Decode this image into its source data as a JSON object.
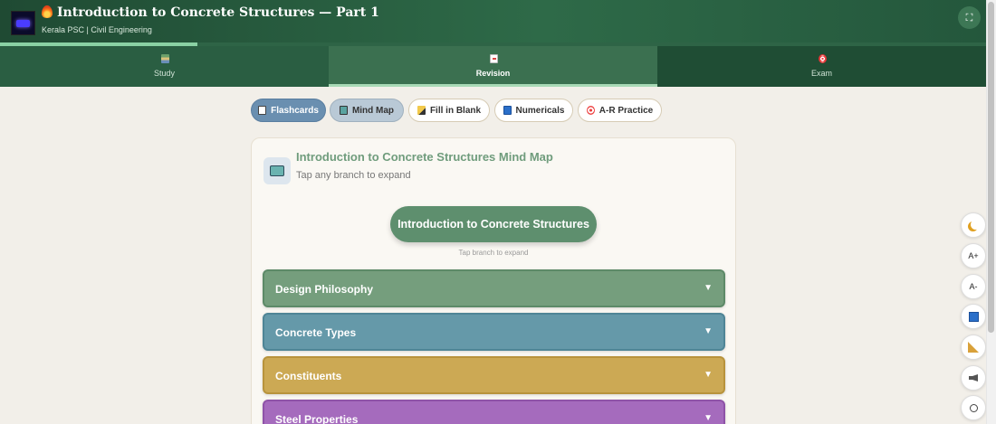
{
  "header": {
    "title": "Introduction to Concrete Structures — Part 1",
    "title_icon": "fire-icon",
    "subtitle": "Kerala PSC | Civil Engineering",
    "expand_icon": "⛶",
    "progress": 0.2
  },
  "tabs": [
    {
      "label": "Study",
      "icon": "books-icon",
      "active": false
    },
    {
      "label": "Revision",
      "icon": "memo-icon",
      "active": true
    },
    {
      "label": "Exam",
      "icon": "target-icon",
      "active": false
    }
  ],
  "modes": [
    {
      "label": "Flashcards",
      "icon": "card-icon",
      "state": "active"
    },
    {
      "label": "Mind Map",
      "icon": "map-icon",
      "state": "selected"
    },
    {
      "label": "Fill in Blank",
      "icon": "pencil-icon",
      "state": "default"
    },
    {
      "label": "Numericals",
      "icon": "numbers-icon",
      "state": "default"
    },
    {
      "label": "A-R Practice",
      "icon": "dart-icon",
      "state": "default"
    }
  ],
  "mindmap": {
    "title": "Introduction to Concrete Structures Mind Map",
    "subtitle": "Tap any branch to expand",
    "root": "Introduction to Concrete Structures",
    "root_hint": "Tap branch to expand",
    "branches": [
      {
        "label": "Design Philosophy",
        "arrow": "▼",
        "color": "#759e7d"
      },
      {
        "label": "Concrete Types",
        "arrow": "▼",
        "color": "#6599a9"
      },
      {
        "label": "Constituents",
        "arrow": "▼",
        "color": "#cca954"
      },
      {
        "label": "Steel Properties",
        "arrow": "▼",
        "color": "#a56bbd"
      }
    ]
  },
  "side_tools": [
    {
      "label": "",
      "icon": "moon-icon"
    },
    {
      "label": "A+",
      "icon": "font-increase-icon"
    },
    {
      "label": "A-",
      "icon": "font-decrease-icon"
    },
    {
      "label": "",
      "icon": "abacus-icon"
    },
    {
      "label": "",
      "icon": "ruler-icon"
    },
    {
      "label": "",
      "icon": "speaker-icon"
    },
    {
      "label": "",
      "icon": "power-icon"
    }
  ]
}
